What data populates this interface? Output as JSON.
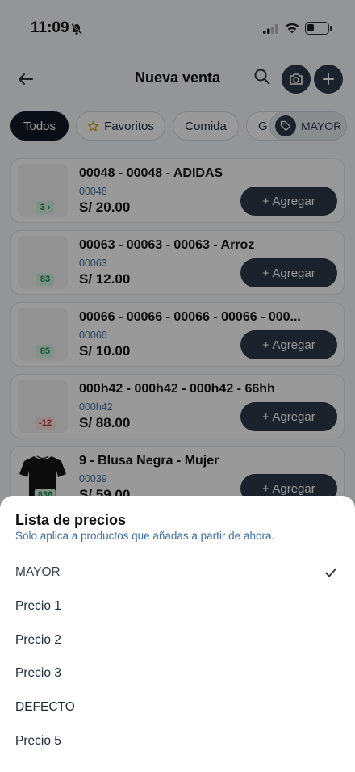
{
  "status_bar": {
    "time": "11:09"
  },
  "header": {
    "title": "Nueva venta"
  },
  "filters": {
    "chips": [
      "Todos",
      "Favoritos",
      "Comida",
      "G"
    ],
    "price_list_chip": "MAYOR"
  },
  "products": [
    {
      "name": "00048 - 00048 - ADIDAS",
      "code": "00048",
      "price": "S/ 20.00",
      "stock": "3 ›",
      "add_label": "+ Agregar"
    },
    {
      "name": "00063 - 00063 - 00063 - Arroz",
      "code": "00063",
      "price": "S/ 12.00",
      "stock": "83",
      "add_label": "+ Agregar"
    },
    {
      "name": "00066 - 00066 - 00066 - 00066 - 000...",
      "code": "00066",
      "price": "S/ 10.00",
      "stock": "85",
      "add_label": "+ Agregar"
    },
    {
      "name": "000h42 - 000h42 - 000h42 - 66hh",
      "code": "000h42",
      "price": "S/ 88.00",
      "stock": "-12",
      "add_label": "+ Agregar"
    },
    {
      "name": "9 - Blusa Negra - Mujer",
      "code": "00039",
      "price": "S/ 59.00",
      "stock": "836",
      "add_label": "+ Agregar"
    }
  ],
  "sheet": {
    "title": "Lista de precios",
    "subtitle": "Solo aplica a productos que añadas a partir de ahora.",
    "options": [
      "MAYOR",
      "Precio 1",
      "Precio 2",
      "Precio 3",
      "DEFECTO",
      "Precio 5"
    ],
    "selected": "MAYOR"
  },
  "colors": {
    "accent": "#2f3a4a",
    "link": "#3b6fa3",
    "stock_positive": "#1b8a4c",
    "stock_negative": "#c0392b"
  }
}
